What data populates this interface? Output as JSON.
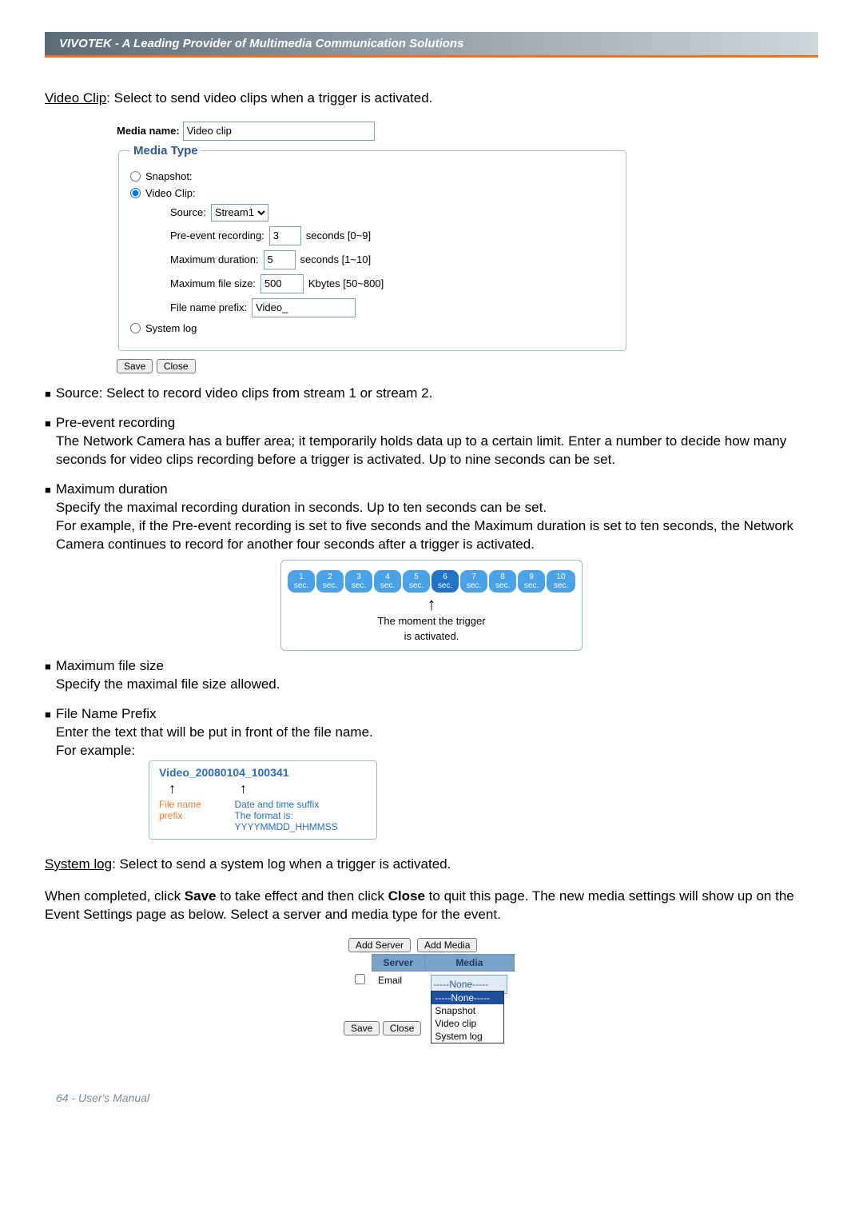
{
  "header": "VIVOTEK - A Leading Provider of Multimedia Communication Solutions",
  "section": {
    "video_clip_title": "Video Clip",
    "video_clip_desc": ": Select to send video clips when a trigger is activated."
  },
  "media": {
    "name_label": "Media name:",
    "name_value": "Video clip",
    "legend": "Media Type",
    "snapshot_label": "Snapshot:",
    "videoclip_label": "Video Clip:",
    "systemlog_label": "System log",
    "source_label": "Source:",
    "source_value": "Stream1",
    "pre_label": "Pre-event recording:",
    "pre_value": "3",
    "pre_hint": "seconds [0~9]",
    "dur_label": "Maximum duration:",
    "dur_value": "5",
    "dur_hint": "seconds [1~10]",
    "size_label": "Maximum file size:",
    "size_value": "500",
    "size_hint": "Kbytes [50~800]",
    "prefix_label": "File name prefix:",
    "prefix_value": "Video_",
    "save_btn": "Save",
    "close_btn": "Close"
  },
  "bullets": {
    "source": "Source: Select to record video clips from stream 1 or stream 2.",
    "pre_title": "Pre-event recording",
    "pre_body": "The Network Camera has a buffer area; it temporarily holds data up to a certain limit. Enter a number to decide how many seconds for video clips recording before a trigger is activated. Up to nine seconds can be set.",
    "dur_title": "Maximum duration",
    "dur_body1": "Specify the maximal recording duration in seconds. Up to ten seconds can be set.",
    "dur_body2": "For example, if the Pre-event recording is set to five seconds and the Maximum duration is set to ten seconds, the Network Camera continues to record for another four seconds after a trigger is activated.",
    "size_title": "Maximum file size",
    "size_body": "Specify the maximal file size allowed.",
    "name_title": "File Name Prefix",
    "name_body": "Enter the text that will be put in front of the file name.",
    "for_example": "For example:"
  },
  "timeline": {
    "secs": [
      "1 sec.",
      "2 sec.",
      "3 sec.",
      "4 sec.",
      "5 sec.",
      "6 sec.",
      "7 sec.",
      "8 sec.",
      "9 sec.",
      "10 sec."
    ],
    "active_index": 5,
    "caption1": "The moment the trigger",
    "caption2": "is activated."
  },
  "example": {
    "prefix": "Video_",
    "suffix": "20080104_100341",
    "lbl_prefix": "File name prefix",
    "lbl_suffix1": "Date and time suffix",
    "lbl_suffix2": "The format is: YYYYMMDD_HHMMSS"
  },
  "syslog": {
    "title": "System log",
    "desc": ": Select to send a system log when a trigger is activated."
  },
  "completion": {
    "p1a": "When completed, click ",
    "save": "Save",
    "p1b": " to take effect and then click ",
    "close": "Close",
    "p1c": " to quit this page. The new media settings will show up on the Event Settings page as below. Select a server and media type for the event."
  },
  "event_panel": {
    "add_server": "Add Server",
    "add_media": "Add Media",
    "col_server": "Server",
    "col_media": "Media",
    "row_server": "Email",
    "media_selected": "-----None-----",
    "options": [
      "-----None-----",
      "Snapshot",
      "Video clip",
      "System log"
    ],
    "save": "Save",
    "close": "Close"
  },
  "footer": "64 - User's Manual"
}
